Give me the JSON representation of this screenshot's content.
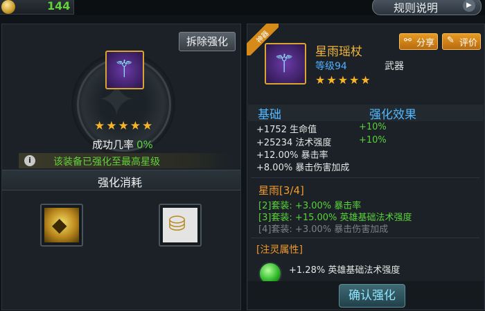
{
  "top": {
    "currency_value": "144",
    "rules_label": "规则说明",
    "rules_arrow": "▶"
  },
  "left": {
    "dismantle_label": "拆除强化",
    "stars": "★★★★★",
    "success_label": "成功几率",
    "success_value": "0%",
    "info_icon": "i",
    "info_text": "该装备已强化至最高星级",
    "cost_title": "强化消耗"
  },
  "right": {
    "tag": "神器",
    "item_name": "星雨瑶杖",
    "item_level": "等级94",
    "item_type": "武器",
    "stars": "★★★★★",
    "share_label": "分享",
    "review_label": "评价",
    "base_title": "基础",
    "enhance_title": "强化效果",
    "stats": [
      {
        "text": "+1752 生命值",
        "bonus": "+10%"
      },
      {
        "text": "+25234 法术强度",
        "bonus": "+10%"
      },
      {
        "text": "+12.00% 暴击率",
        "bonus": ""
      },
      {
        "text": "+8.00% 暴击伤害加成",
        "bonus": ""
      }
    ],
    "set_title": "星雨[3/4]",
    "set_bonuses": [
      "[2]套装: +3.00% 暴击率",
      "[3]套装: +15.00% 英雄基础法术强度",
      "[4]套装: +3.00% 暴击伤害加成"
    ],
    "spirit_title": "[注灵属性]",
    "spirit_text": "+1.28% 英雄基础法术强度",
    "confirm_label": "确认强化"
  },
  "colors": {
    "gold": "#f2b63a",
    "green": "#5ad33a",
    "blue": "#52b8ff",
    "orange": "#e89a22"
  },
  "icons": {
    "currency": "coin-icon",
    "staff": "staff-icon",
    "dismantle_material": "enhance-stone-icon",
    "gold_material": "gold-coins-icon",
    "share": "share-icon",
    "review": "edit-icon",
    "spirit": "spirit-orb-icon"
  }
}
